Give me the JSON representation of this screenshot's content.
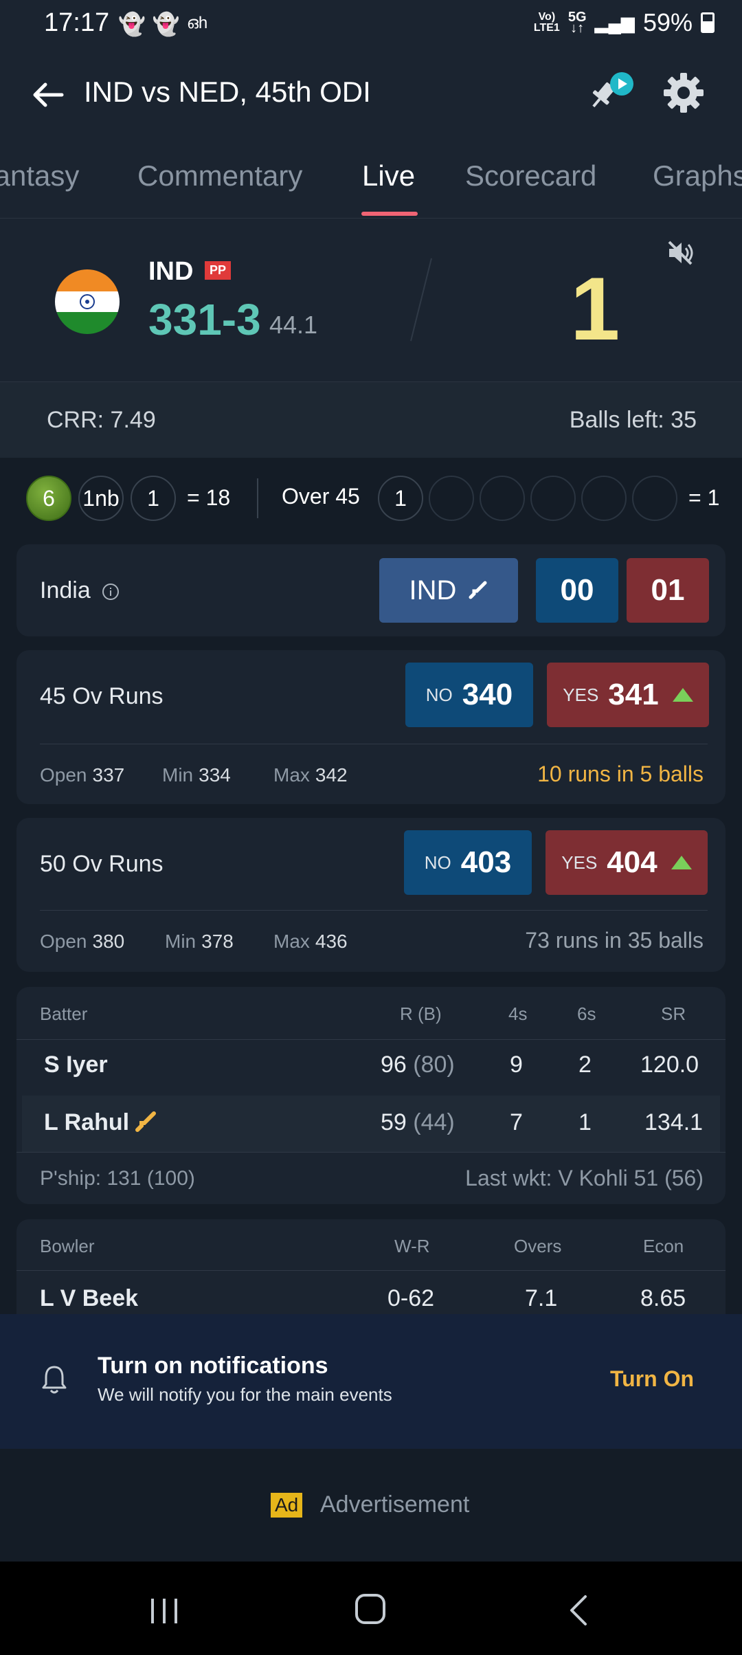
{
  "status_bar": {
    "time": "17:17",
    "left_icons": [
      "snapchat-icon",
      "snapchat-icon",
      "translate-icon"
    ],
    "network_top": "Vo)",
    "network_bottom": "LTE1",
    "network_type": "5G",
    "battery": "59%"
  },
  "header": {
    "title": "IND vs NED, 45th ODI"
  },
  "tabs": [
    "Fantasy",
    "Commentary",
    "Live",
    "Scorecard",
    "Graphs"
  ],
  "active_tab": "Live",
  "score": {
    "team": "IND",
    "badge": "PP",
    "runs": "331-3",
    "overs": "44.1",
    "last_ball": "1"
  },
  "rates": {
    "crr": "CRR: 7.49",
    "balls_left": "Balls left: 35"
  },
  "overs_strip": {
    "prev_balls": [
      "6",
      "1nb",
      "1"
    ],
    "prev_total": "= 18",
    "current_label": "Over 45",
    "current_balls": [
      "1",
      "",
      "",
      "",
      "",
      ""
    ],
    "current_total": "= 1"
  },
  "odds": {
    "team_label": "India",
    "team_pill": "IND",
    "back": "00",
    "lay": "01"
  },
  "sessions": [
    {
      "label": "45 Ov Runs",
      "no_label": "NO",
      "no_value": "340",
      "yes_label": "YES",
      "yes_value": "341",
      "open_label": "Open",
      "open": "337",
      "min_label": "Min",
      "min": "334",
      "max_label": "Max",
      "max": "342",
      "projection": "10 runs in 5 balls"
    },
    {
      "label": "50 Ov Runs",
      "no_label": "NO",
      "no_value": "403",
      "yes_label": "YES",
      "yes_value": "404",
      "open_label": "Open",
      "open": "380",
      "min_label": "Min",
      "min": "378",
      "max_label": "Max",
      "max": "436",
      "projection": "73 runs in 35 balls"
    }
  ],
  "batting": {
    "headers": [
      "Batter",
      "R (B)",
      "4s",
      "6s",
      "SR"
    ],
    "rows": [
      {
        "name": "S Iyer",
        "runs": "96",
        "balls": "(80)",
        "fours": "9",
        "sixes": "2",
        "sr": "120.0"
      },
      {
        "name": "L Rahul",
        "runs": "59",
        "balls": "(44)",
        "fours": "7",
        "sixes": "1",
        "sr": "134.1"
      }
    ],
    "partnership": "P'ship: 131 (100)",
    "last_wicket": "Last wkt: V Kohli 51 (56)"
  },
  "bowling": {
    "headers": [
      "Bowler",
      "W-R",
      "Overs",
      "Econ"
    ],
    "rows": [
      {
        "name": "L V Beek",
        "wr": "0-62",
        "overs": "7.1",
        "econ": "8.65"
      }
    ]
  },
  "notification": {
    "title": "Turn on notifications",
    "subtitle": "We will notify you for the main events",
    "action": "Turn On"
  },
  "ad": {
    "badge": "Ad",
    "text": "Advertisement"
  }
}
